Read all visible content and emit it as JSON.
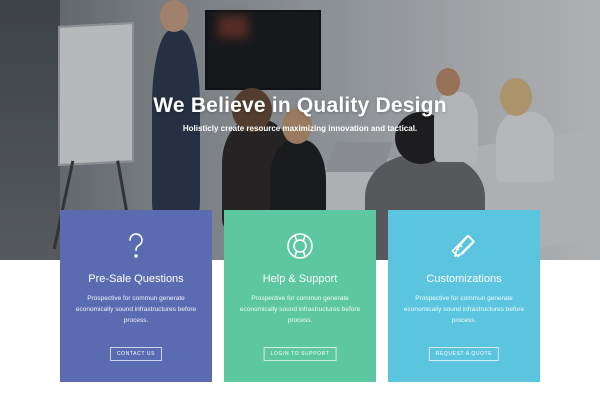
{
  "hero": {
    "title": "We Believe in Quality Design",
    "subtitle": "Holisticly create resource maximizing innovation and tactical."
  },
  "cards": [
    {
      "icon": "question-icon",
      "title": "Pre-Sale Questions",
      "text": "Prospective for commun generate economically sound infrastructures before process.",
      "button": "CONTACT US",
      "color": "#5b6bb2"
    },
    {
      "icon": "lifebuoy-icon",
      "title": "Help & Support",
      "text": "Prospective for commun generate economically sound infrastructures before process.",
      "button": "LOGIN TO SUPPORT",
      "color": "#5cc7a0"
    },
    {
      "icon": "pencil-ruler-icon",
      "title": "Customizations",
      "text": "Prospective for commun generate economically sound infrastructures before process.",
      "button": "REQUEST A QUOTE",
      "color": "#5bc4df"
    }
  ]
}
